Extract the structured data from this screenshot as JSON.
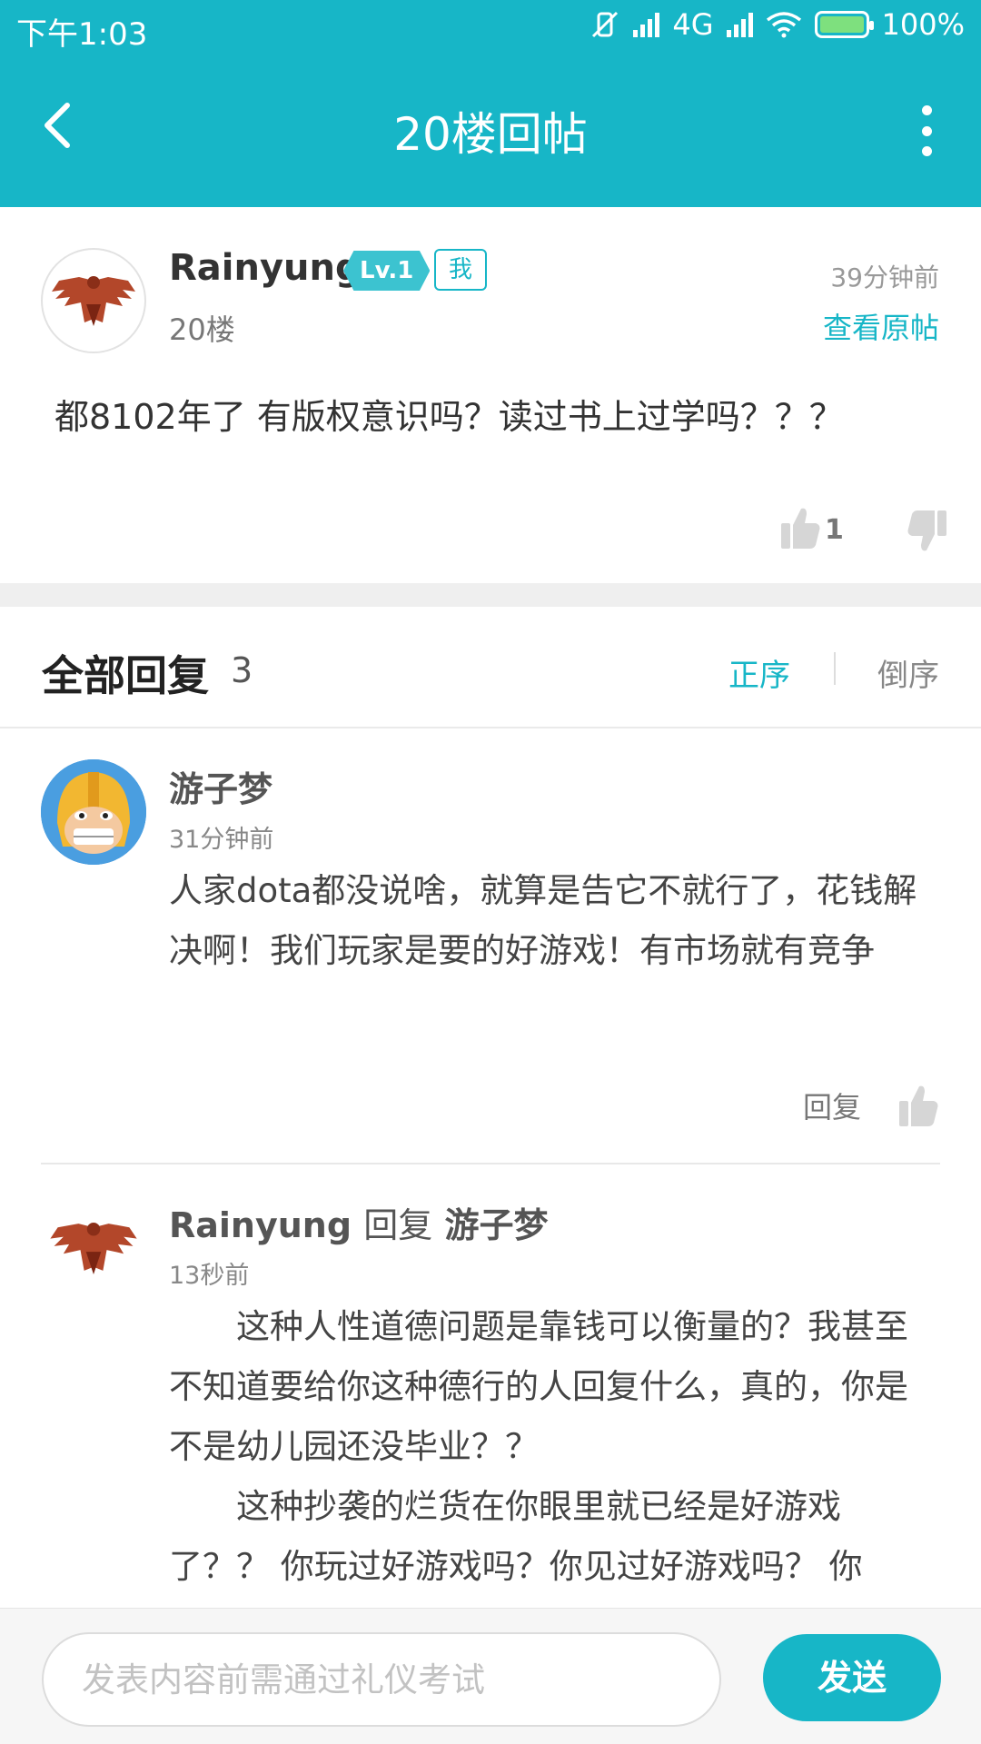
{
  "status_bar": {
    "time": "下午1:03",
    "network": "4G",
    "battery": "100%"
  },
  "app_bar": {
    "title": "20楼回帖"
  },
  "post": {
    "author": "Rainyung",
    "level": "Lv.1",
    "me_tag": "我",
    "floor": "20楼",
    "time": "39分钟前",
    "view_original": "查看原帖",
    "content": "都8102年了 有版权意识吗？读过书上过学吗？？？",
    "like_count": "1"
  },
  "replies_header": {
    "title": "全部回复",
    "count": "3",
    "sort_asc": "正序",
    "sort_desc": "倒序"
  },
  "replies": [
    {
      "author": "游子梦",
      "time": "31分钟前",
      "content": "人家dota都没说啥，就算是告它不就行了，花钱解决啊！我们玩家是要的好游戏！有市场就有竞争",
      "reply_label": "回复"
    },
    {
      "author": "Rainyung",
      "reply_word": "回复",
      "reply_to": "游子梦",
      "time": "13秒前",
      "paragraphs": [
        "这种人性道德问题是靠钱可以衡量的？我甚至不知道要给你这种德行的人回复什么，真的，你是不是幼儿园还没毕业？？",
        "这种抄袭的烂货在你眼里就已经是好游戏了？？ 你玩过好游戏吗？你见过好游戏吗？ 你"
      ]
    }
  ],
  "input": {
    "placeholder": "发表内容前需通过礼仪考试",
    "send_label": "发送"
  },
  "colors": {
    "accent": "#17b6c7"
  }
}
